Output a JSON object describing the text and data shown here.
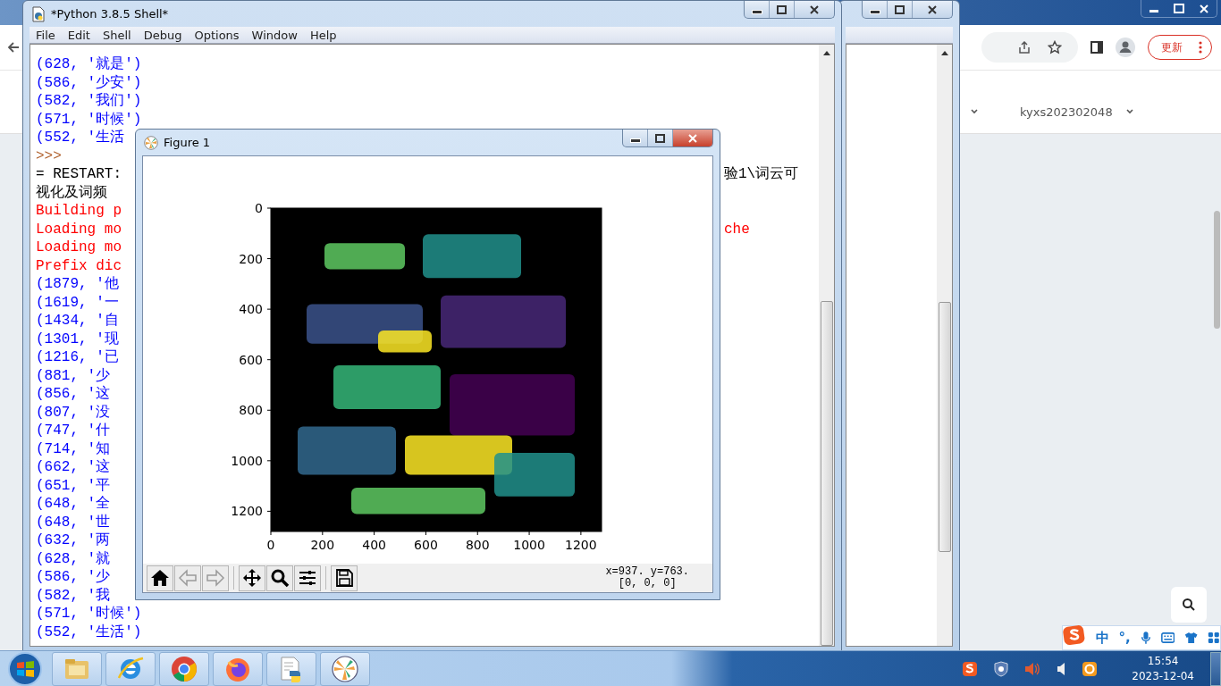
{
  "browser": {
    "update_button": "更新",
    "nav_items": [
      {
        "label": "kyxs202302048"
      }
    ]
  },
  "shell": {
    "title": "*Python 3.8.5 Shell*",
    "menu": [
      "File",
      "Edit",
      "Shell",
      "Debug",
      "Options",
      "Window",
      "Help"
    ],
    "lines": [
      {
        "kind": "output",
        "text": "(628, '就是')"
      },
      {
        "kind": "output",
        "text": "(586, '少安')"
      },
      {
        "kind": "output",
        "text": "(582, '我们')"
      },
      {
        "kind": "output",
        "text": "(571, '时候')"
      },
      {
        "kind": "output",
        "text": "(552, '生活"
      },
      {
        "kind": "prompt",
        "text": ">>>"
      },
      {
        "kind": "info",
        "text": "= RESTART:",
        "right": "验1\\词云可"
      },
      {
        "kind": "info",
        "text": "视化及词频"
      },
      {
        "kind": "error",
        "text": "Building p"
      },
      {
        "kind": "error",
        "text": "Loading mo",
        "right": "che"
      },
      {
        "kind": "error",
        "text": "Loading mo"
      },
      {
        "kind": "error",
        "text": "Prefix dic"
      },
      {
        "kind": "output",
        "text": "(1879, '他"
      },
      {
        "kind": "output",
        "text": "(1619, '一"
      },
      {
        "kind": "output",
        "text": "(1434, '自"
      },
      {
        "kind": "output",
        "text": "(1301, '现"
      },
      {
        "kind": "output",
        "text": "(1216, '已"
      },
      {
        "kind": "output",
        "text": "(881, '少"
      },
      {
        "kind": "output",
        "text": "(856, '这"
      },
      {
        "kind": "output",
        "text": "(807, '没"
      },
      {
        "kind": "output",
        "text": "(747, '什"
      },
      {
        "kind": "output",
        "text": "(714, '知"
      },
      {
        "kind": "output",
        "text": "(662, '这"
      },
      {
        "kind": "output",
        "text": "(651, '平"
      },
      {
        "kind": "output",
        "text": "(648, '全"
      },
      {
        "kind": "output",
        "text": "(648, '世"
      },
      {
        "kind": "output",
        "text": "(632, '两"
      },
      {
        "kind": "output",
        "text": "(628, '就"
      },
      {
        "kind": "output",
        "text": "(586, '少"
      },
      {
        "kind": "output",
        "text": "(582, '我"
      },
      {
        "kind": "output",
        "text": "(571, '时候')"
      },
      {
        "kind": "output",
        "text": "(552, '生活')"
      }
    ]
  },
  "figure": {
    "title": "Figure 1",
    "yticks": [
      "0",
      "200",
      "400",
      "600",
      "800",
      "1000",
      "1200"
    ],
    "xticks": [
      "0",
      "200",
      "400",
      "600",
      "800",
      "1000",
      "1200"
    ],
    "toolbar": [
      {
        "kind": "home",
        "disabled": false
      },
      {
        "kind": "back",
        "disabled": true
      },
      {
        "kind": "forward",
        "disabled": true
      },
      {
        "kind": "pan",
        "disabled": false
      },
      {
        "kind": "zoom",
        "disabled": false
      },
      {
        "kind": "subplots",
        "disabled": false
      },
      {
        "kind": "save",
        "disabled": false
      }
    ],
    "coords": "x=937. y=763.",
    "pixel": "[0, 0, 0]"
  },
  "ime": {
    "mode": "中",
    "punct": "°,"
  },
  "taskbar": {
    "apps": [
      {
        "kind": "explorer"
      },
      {
        "kind": "ie"
      },
      {
        "kind": "chrome"
      },
      {
        "kind": "firefox"
      },
      {
        "kind": "idle"
      },
      {
        "kind": "matplotlib"
      }
    ],
    "tray": [
      {
        "kind": "s-logo"
      },
      {
        "kind": "shield"
      },
      {
        "kind": "volume"
      },
      {
        "kind": "speaker"
      },
      {
        "kind": "ring"
      }
    ],
    "time": "15:54",
    "date": "2023-12-04"
  }
}
